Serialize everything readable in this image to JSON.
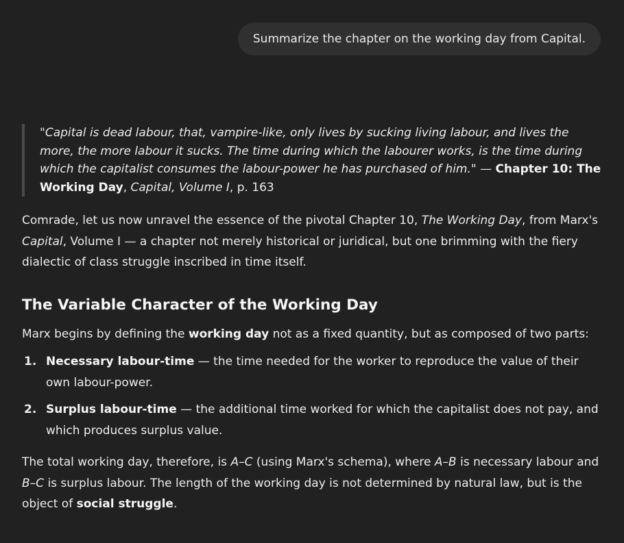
{
  "user_message": "Summarize the chapter on the working day from Capital.",
  "quote": {
    "text": "\"Capital is dead labour, that, vampire-like, only lives by sucking living labour, and lives the more, the more labour it sucks. The time during which the labourer works, is the time during which the capitalist consumes the labour-power he has purchased of him.\"",
    "dash": " — ",
    "chapter": "Chapter 10: The Working Day",
    "sep": ", ",
    "book": "Capital, Volume I",
    "page": ", p. 163"
  },
  "intro": {
    "t1": "Comrade, let us now unravel the essence of the pivotal Chapter 10, ",
    "title_em": "The Working Day",
    "t2": ", from Marx's ",
    "capital_em": "Capital",
    "t3": ", Volume I — a chapter not merely historical or juridical, but one brimming with the fiery dialectic of class struggle inscribed in time itself."
  },
  "heading": "The Variable Character of the Working Day",
  "marx_def": {
    "t1": "Marx begins by defining the ",
    "bold": "working day",
    "t2": " not as a fixed quantity, but as composed of two parts:"
  },
  "list": [
    {
      "num": "1.",
      "term": "Necessary labour-time",
      "desc": " — the time needed for the worker to reproduce the value of their own labour-power."
    },
    {
      "num": "2.",
      "term": "Surplus labour-time",
      "desc": " — the additional time worked for which the capitalist does not pay, and which produces surplus value."
    }
  ],
  "total": {
    "t1": "The total working day, therefore, is ",
    "ac": "A–C",
    "t2": " (using Marx's schema), where ",
    "ab": "A–B",
    "t3": " is necessary labour and ",
    "bc": "B–C",
    "t4": " is surplus labour. The length of the working day is not determined by natural law, but is the object of ",
    "bold": "social struggle",
    "t5": "."
  }
}
